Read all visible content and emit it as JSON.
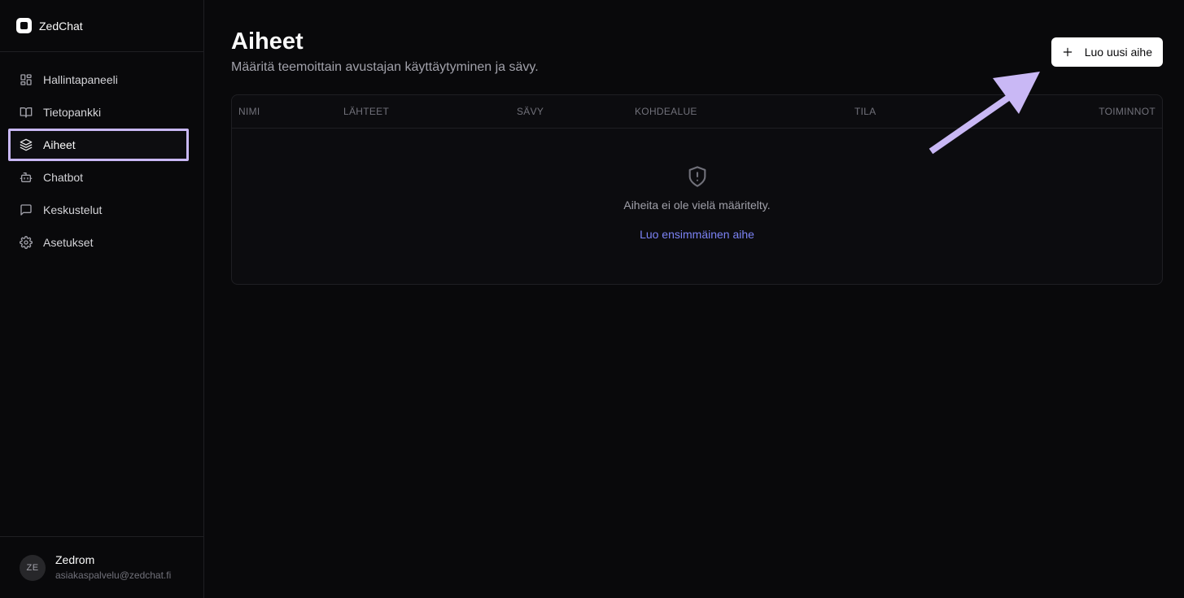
{
  "brand": {
    "name": "ZedChat"
  },
  "sidebar": {
    "items": [
      {
        "label": "Hallintapaneeli",
        "icon": "dashboard-icon"
      },
      {
        "label": "Tietopankki",
        "icon": "book-open-icon"
      },
      {
        "label": "Aiheet",
        "icon": "layers-icon",
        "active": true
      },
      {
        "label": "Chatbot",
        "icon": "bot-icon"
      },
      {
        "label": "Keskustelut",
        "icon": "message-square-icon"
      },
      {
        "label": "Asetukset",
        "icon": "gear-icon"
      }
    ]
  },
  "user": {
    "initials": "ZE",
    "name": "Zedrom",
    "email": "asiakaspalvelu@zedchat.fi"
  },
  "main": {
    "title": "Aiheet",
    "subtitle": "Määritä teemoittain avustajan käyttäytyminen ja sävy.",
    "create_button": "Luo uusi aihe",
    "table": {
      "columns": [
        "NIMI",
        "LÄHTEET",
        "SÄVY",
        "KOHDEALUE",
        "TILA",
        "TOIMINNOT"
      ],
      "empty_icon": "shield-alert-icon",
      "empty_text": "Aiheita ei ole vielä määritelty.",
      "empty_link": "Luo ensimmäinen aihe"
    }
  },
  "colors": {
    "background": "#09090b",
    "accent_link": "#7c83f5",
    "highlight": "#c9b8f5"
  }
}
